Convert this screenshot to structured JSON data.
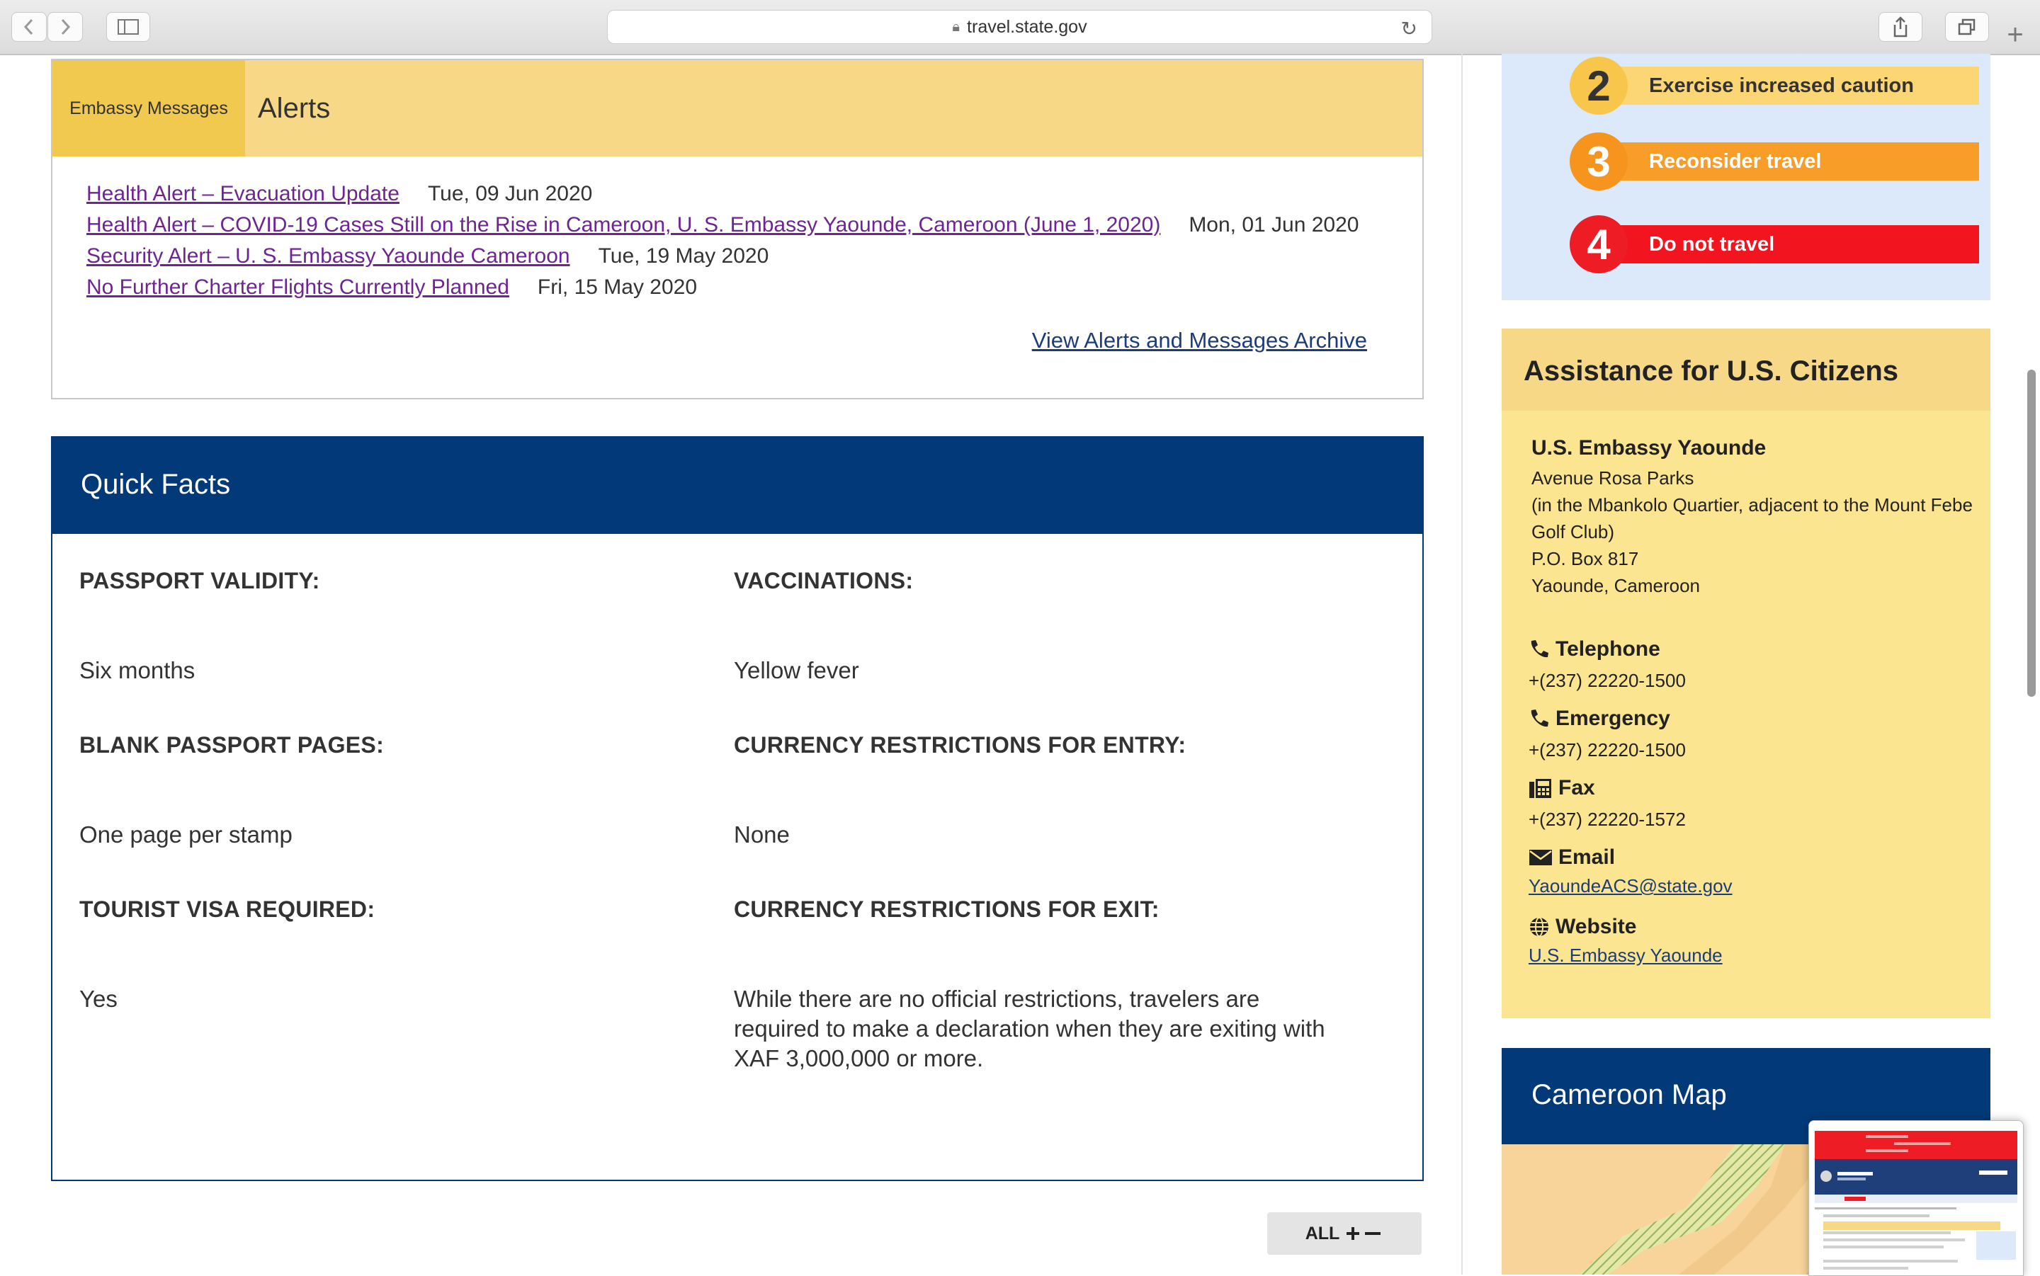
{
  "browser": {
    "url": "travel.state.gov"
  },
  "alerts_box": {
    "tab_embassy_messages": "Embassy Messages",
    "tab_alerts": "Alerts",
    "items": [
      {
        "title": "Health Alert – Evacuation Update",
        "date": "Tue, 09 Jun 2020"
      },
      {
        "title": "Health Alert – COVID-19 Cases Still on the Rise in Cameroon, U. S. Embassy Yaounde, Cameroon (June 1, 2020)",
        "date": "Mon, 01 Jun 2020"
      },
      {
        "title": "Security Alert – U. S. Embassy Yaounde Cameroon",
        "date": "Tue, 19 May 2020"
      },
      {
        "title": "No Further Charter Flights Currently Planned",
        "date": "Fri, 15 May 2020"
      }
    ],
    "archive_link": "View Alerts and Messages Archive"
  },
  "quick_facts": {
    "title": "Quick Facts",
    "passport_validity_label": "PASSPORT VALIDITY:",
    "passport_validity_value": "Six months",
    "vaccinations_label": "VACCINATIONS:",
    "vaccinations_value": "Yellow fever",
    "blank_pages_label": "BLANK PASSPORT PAGES:",
    "blank_pages_value": "One page per stamp",
    "currency_entry_label": "CURRENCY RESTRICTIONS FOR ENTRY:",
    "currency_entry_value": "None",
    "tourist_visa_label": "TOURIST VISA REQUIRED:",
    "tourist_visa_value": "Yes",
    "currency_exit_label": "CURRENCY RESTRICTIONS FOR EXIT:",
    "currency_exit_line1": "While there are no official restrictions, travelers are",
    "currency_exit_line2": "required to make a declaration when they are exiting with",
    "currency_exit_line3": "XAF 3,000,000 or more."
  },
  "all_toggle": "ALL",
  "advisory_levels": [
    {
      "num": "2",
      "label": "Exercise increased caution",
      "color": "#f8c64a",
      "bar": "#fcd675",
      "text": "#333333"
    },
    {
      "num": "3",
      "label": "Reconsider travel",
      "color": "#f7941d",
      "bar": "#f99d29",
      "text": "#ffffff"
    },
    {
      "num": "4",
      "label": "Do not travel",
      "color": "#ee1c24",
      "bar": "#f2141e",
      "text": "#ffffff"
    }
  ],
  "assistance": {
    "title": "Assistance for U.S. Citizens",
    "embassy_name": "U.S. Embassy Yaounde",
    "address_1": "Avenue Rosa Parks",
    "address_2": "(in the Mbankolo Quartier, adjacent to the Mount Febe",
    "address_3": "Golf Club)",
    "address_4": "P.O. Box 817",
    "address_5": "Yaounde, Cameroon",
    "telephone_label": "Telephone",
    "telephone_value": "+(237) 22220-1500",
    "emergency_label": "Emergency",
    "emergency_value": "+(237) 22220-1500",
    "fax_label": "Fax",
    "fax_value": "+(237) 22220-1572",
    "email_label": "Email",
    "email_value": "YaoundeACS@state.gov",
    "website_label": "Website",
    "website_value": "U.S. Embassy Yaounde"
  },
  "map": {
    "title": "Cameroon Map"
  }
}
